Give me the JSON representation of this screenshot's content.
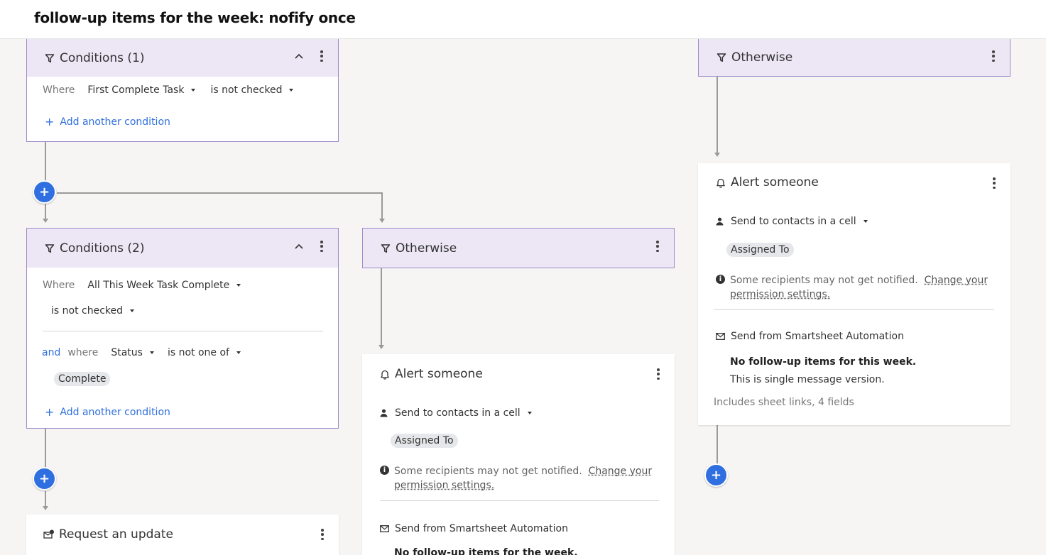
{
  "page_title": "follow-up items for the week: nofify once",
  "conditions1": {
    "title": "Conditions (1)",
    "where_label": "Where",
    "field": "First Complete Task",
    "operator": "is not checked",
    "add_condition": "Add another condition"
  },
  "conditions2": {
    "title": "Conditions (2)",
    "where_label": "Where",
    "field": "All This Week Task Complete",
    "operator": "is not checked",
    "and_label": "and",
    "where2_label": "where",
    "field2": "Status",
    "operator2": "is not one of",
    "value_chip": "Complete",
    "add_condition": "Add another condition"
  },
  "otherwise_mid": {
    "title": "Otherwise"
  },
  "otherwise_right": {
    "title": "Otherwise"
  },
  "alert_mid": {
    "title": "Alert someone",
    "recipient_type": "Send to contacts in a cell",
    "contact_chip": "Assigned To",
    "warning_text": "Some recipients may not get notified.",
    "warning_link_1": "Change your",
    "warning_link_2": "permission settings.",
    "sender": "Send from Smartsheet Automation",
    "subject": "No follow-up items for the week."
  },
  "alert_right": {
    "title": "Alert someone",
    "recipient_type": "Send to contacts in a cell",
    "contact_chip": "Assigned To",
    "warning_text": "Some recipients may not get notified.",
    "warning_link_1": "Change your",
    "warning_link_2": "permission settings.",
    "sender": "Send from Smartsheet Automation",
    "subject": "No follow-up items for this week.",
    "message": "This is single message version.",
    "includes": "Includes sheet links, 4 fields"
  },
  "request_update": {
    "title": "Request an update"
  },
  "colors": {
    "accent": "#2f6fe0",
    "header_bg": "#ece6f5",
    "border": "#9d8ac9",
    "connector": "#9a9a9a"
  }
}
